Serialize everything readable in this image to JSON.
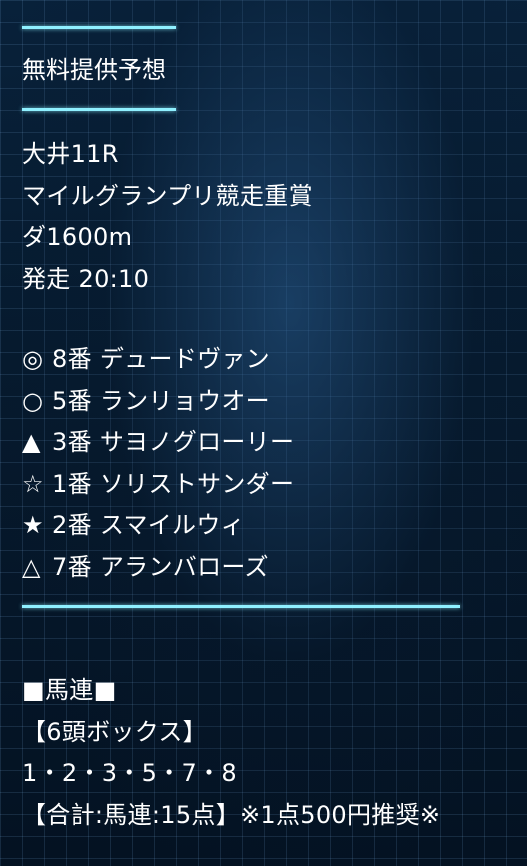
{
  "header": {
    "title": "無料提供予想"
  },
  "race": {
    "venue": "大井11R",
    "name": "マイルグランプリ競走重賞",
    "course": "ダ1600m",
    "start": "発走 20:10"
  },
  "picks": [
    {
      "mark": "◎",
      "number": "8番",
      "horse": "デュードヴァン"
    },
    {
      "mark": "○",
      "number": "5番",
      "horse": "ランリョウオー"
    },
    {
      "mark": "▲",
      "number": "3番",
      "horse": "サヨノグローリー"
    },
    {
      "mark": "☆",
      "number": "1番",
      "horse": "ソリストサンダー"
    },
    {
      "mark": "★",
      "number": "2番",
      "horse": "スマイルウィ"
    },
    {
      "mark": "△",
      "number": "7番",
      "horse": "アランバローズ"
    }
  ],
  "bet": {
    "type": "■馬連■",
    "format": "【6頭ボックス】",
    "numbers": "1・2・3・5・7・8",
    "summary": "【合計:馬連:15点】※1点500円推奨※"
  }
}
